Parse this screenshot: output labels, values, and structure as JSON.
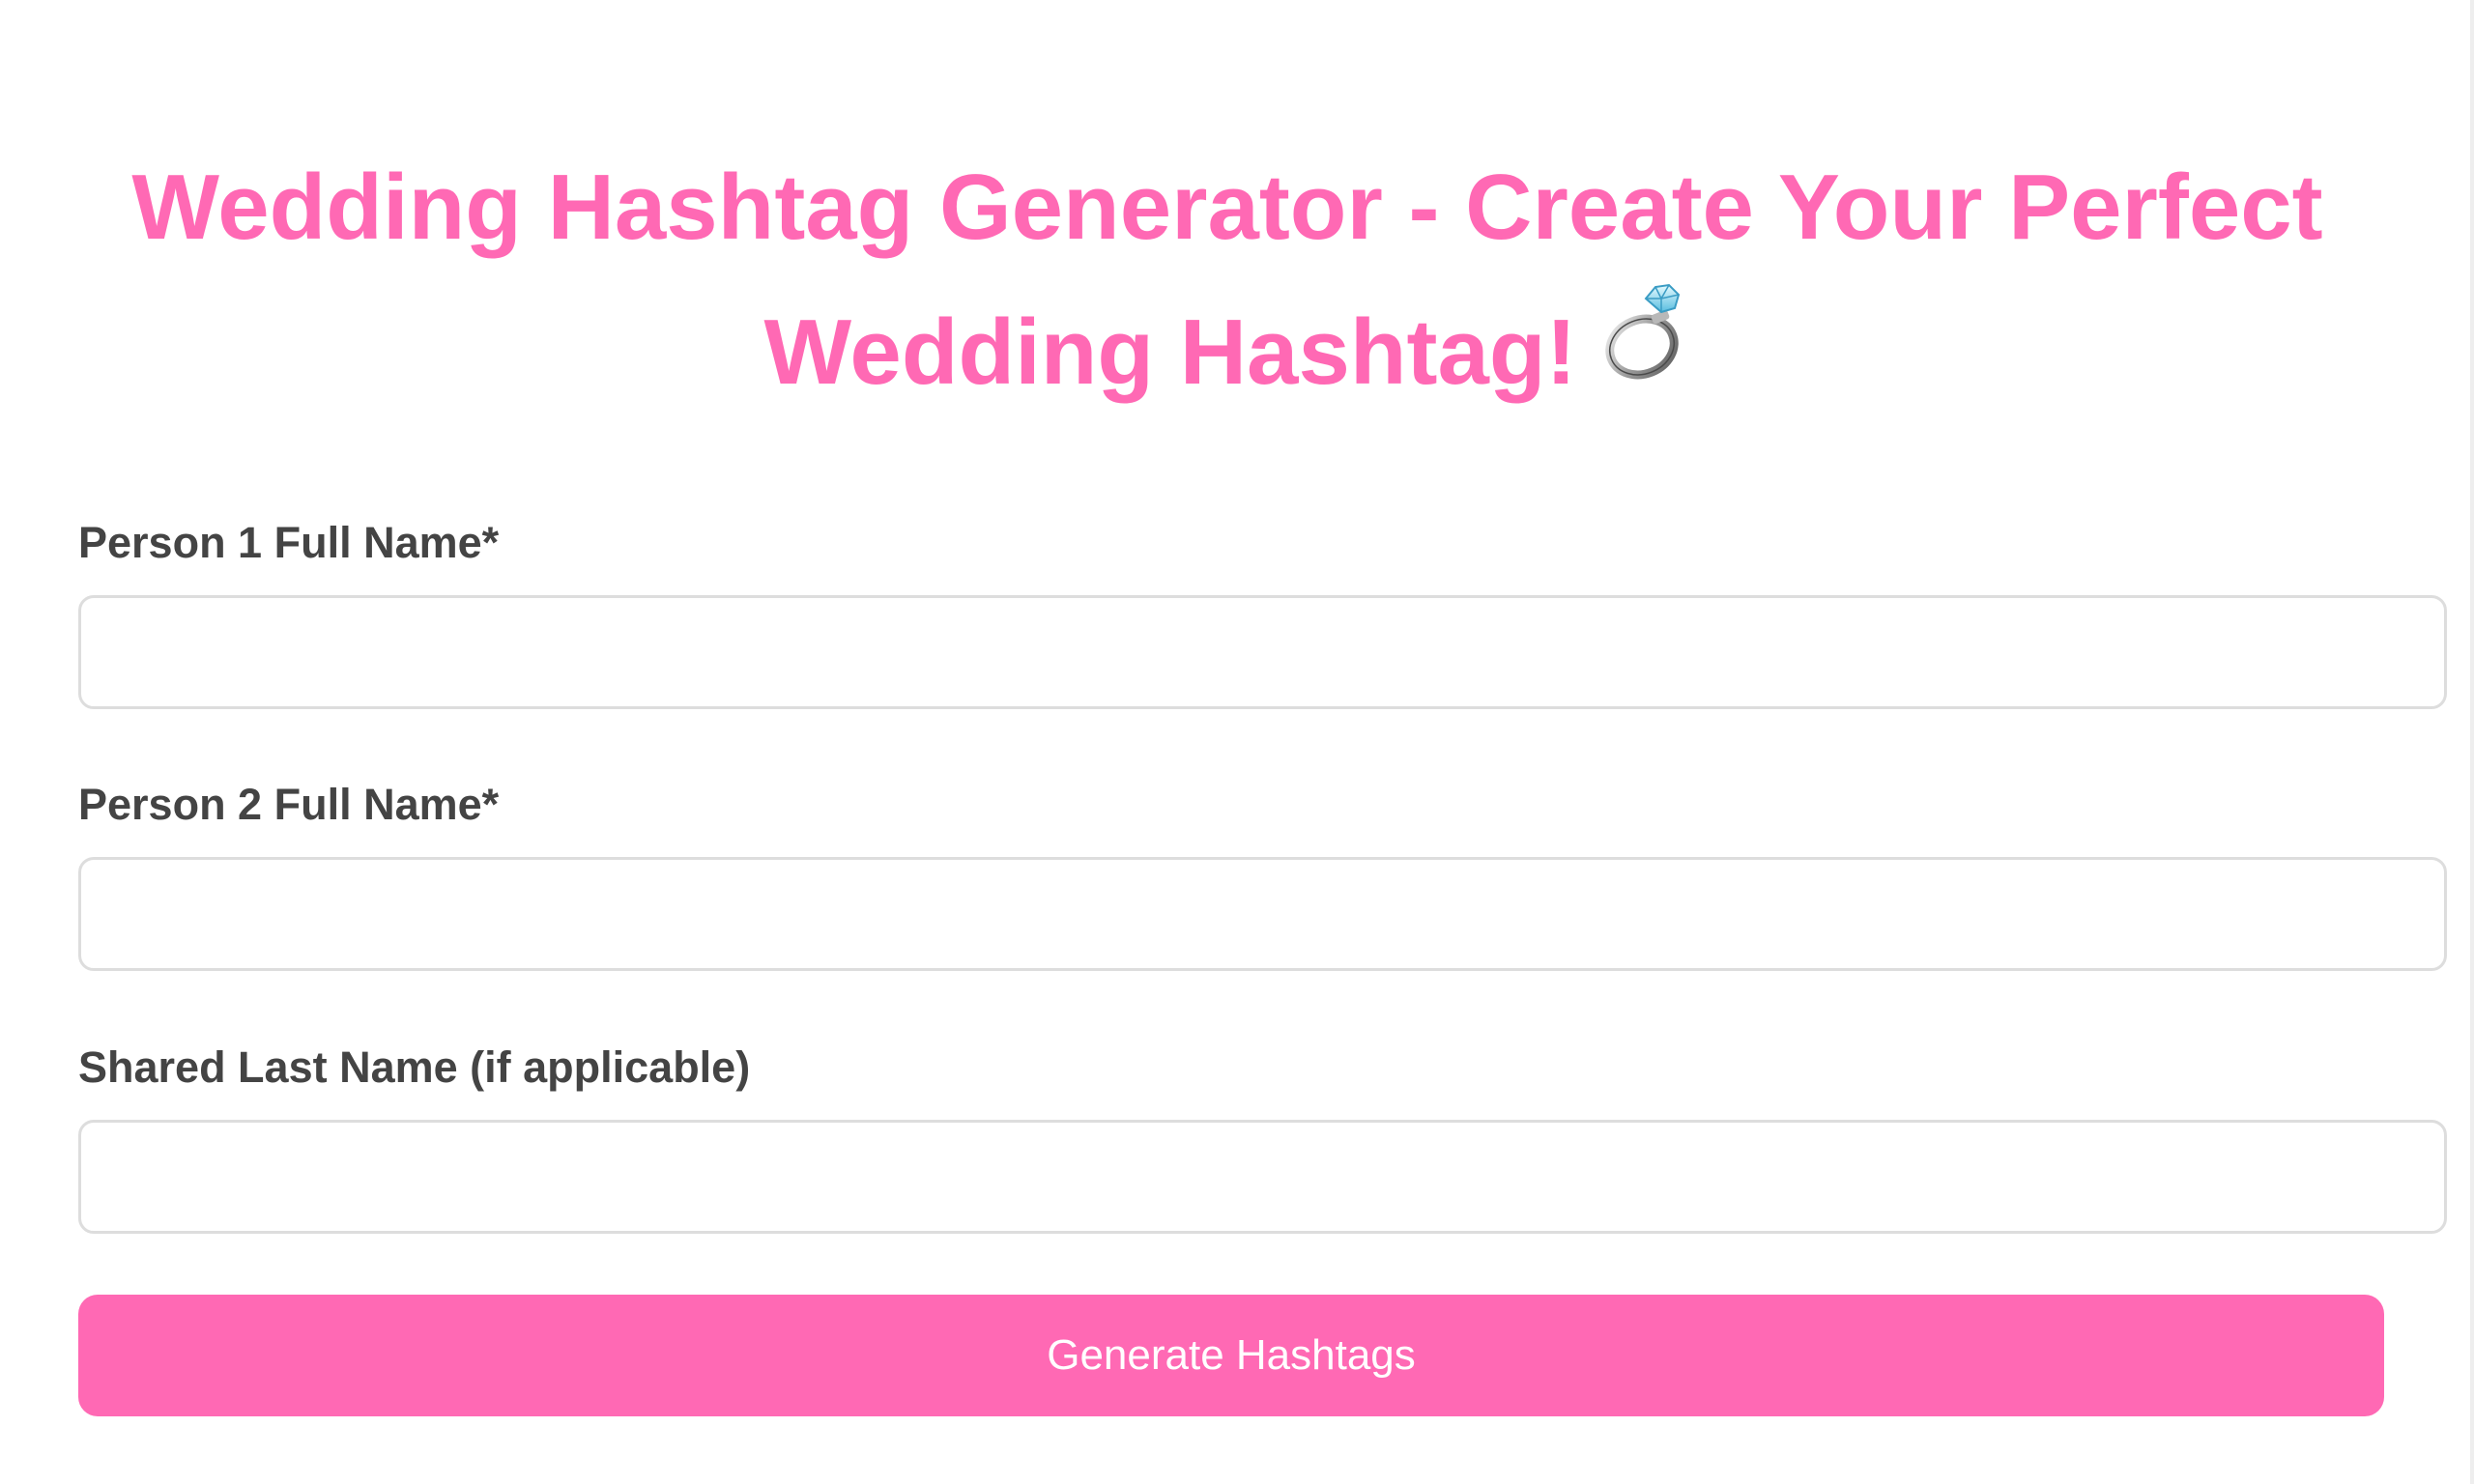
{
  "header": {
    "title": "Wedding Hashtag Generator - Create Your Perfect Wedding Hashtag!",
    "title_icon": "ring-icon"
  },
  "form": {
    "fields": [
      {
        "label": "Person 1 Full Name*",
        "value": "",
        "placeholder": ""
      },
      {
        "label": "Person 2 Full Name*",
        "value": "",
        "placeholder": ""
      },
      {
        "label": "Shared Last Name (if applicable)",
        "value": "",
        "placeholder": ""
      }
    ],
    "submit_label": "Generate Hashtags"
  },
  "colors": {
    "accent": "#ff69b4",
    "label_text": "#444444",
    "input_border": "#dddddd",
    "button_text": "#ffffff"
  }
}
